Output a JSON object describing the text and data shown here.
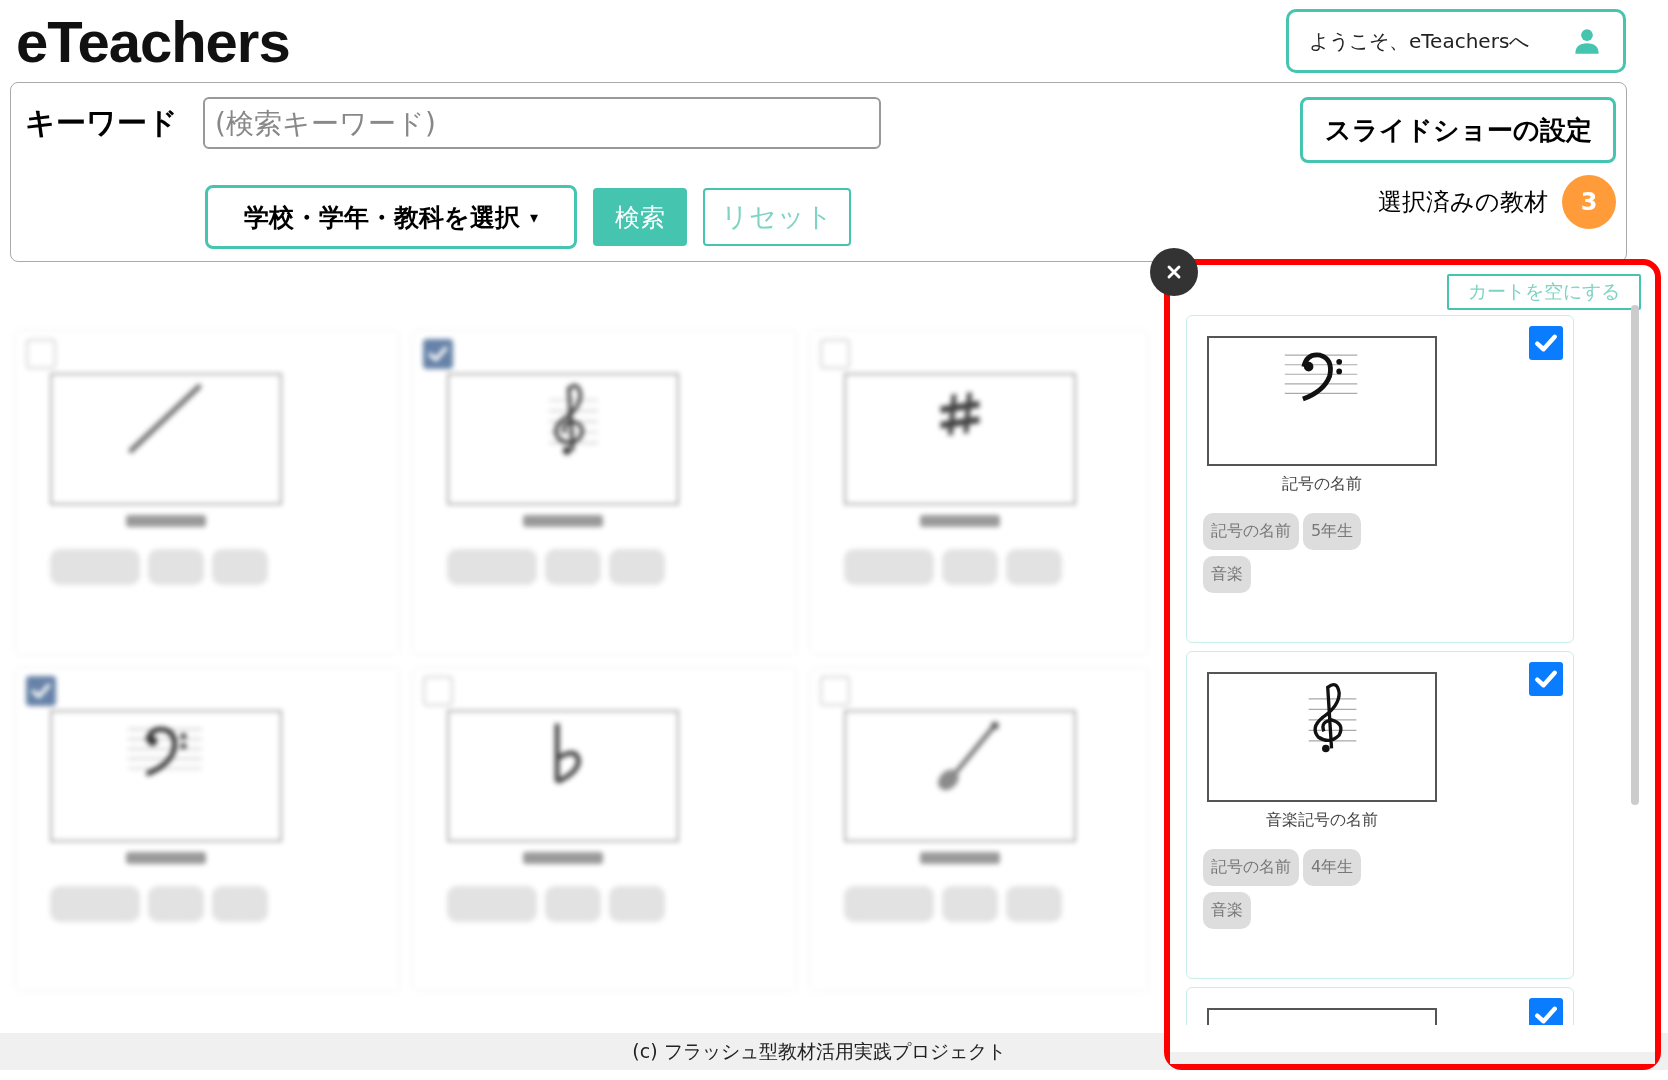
{
  "header": {
    "logo": "eTeachers",
    "welcome": "ようこそ、eTeachersへ"
  },
  "search": {
    "label": "キーワード",
    "placeholder": "(検索キーワード)",
    "filter_button": "学校・学年・教科を選択",
    "filter_caret": "▾",
    "search_button": "検索",
    "reset_button": "リセット",
    "slideshow_button": "スライドショーの設定",
    "selected_label": "選択済みの教材",
    "selected_count": "3"
  },
  "grid": [
    {
      "kind": "baton",
      "checked": false
    },
    {
      "kind": "treble_clef",
      "checked": true
    },
    {
      "kind": "sharp",
      "checked": false
    },
    {
      "kind": "bass_clef",
      "checked": true
    },
    {
      "kind": "flat",
      "checked": false
    },
    {
      "kind": "instrument",
      "checked": false
    }
  ],
  "cart": {
    "empty_button": "カートを空にする",
    "items": [
      {
        "kind": "bass_clef",
        "caption": "記号の名前",
        "tags": [
          "記号の名前",
          "5年生",
          "音楽"
        ],
        "checked": true
      },
      {
        "kind": "treble_clef",
        "caption": "音楽記号の名前",
        "tags": [
          "記号の名前",
          "4年生",
          "音楽"
        ],
        "checked": true
      },
      {
        "checked": true
      }
    ]
  },
  "footer": "(c) フラッシュ型教材活用実践プロジェクト"
}
